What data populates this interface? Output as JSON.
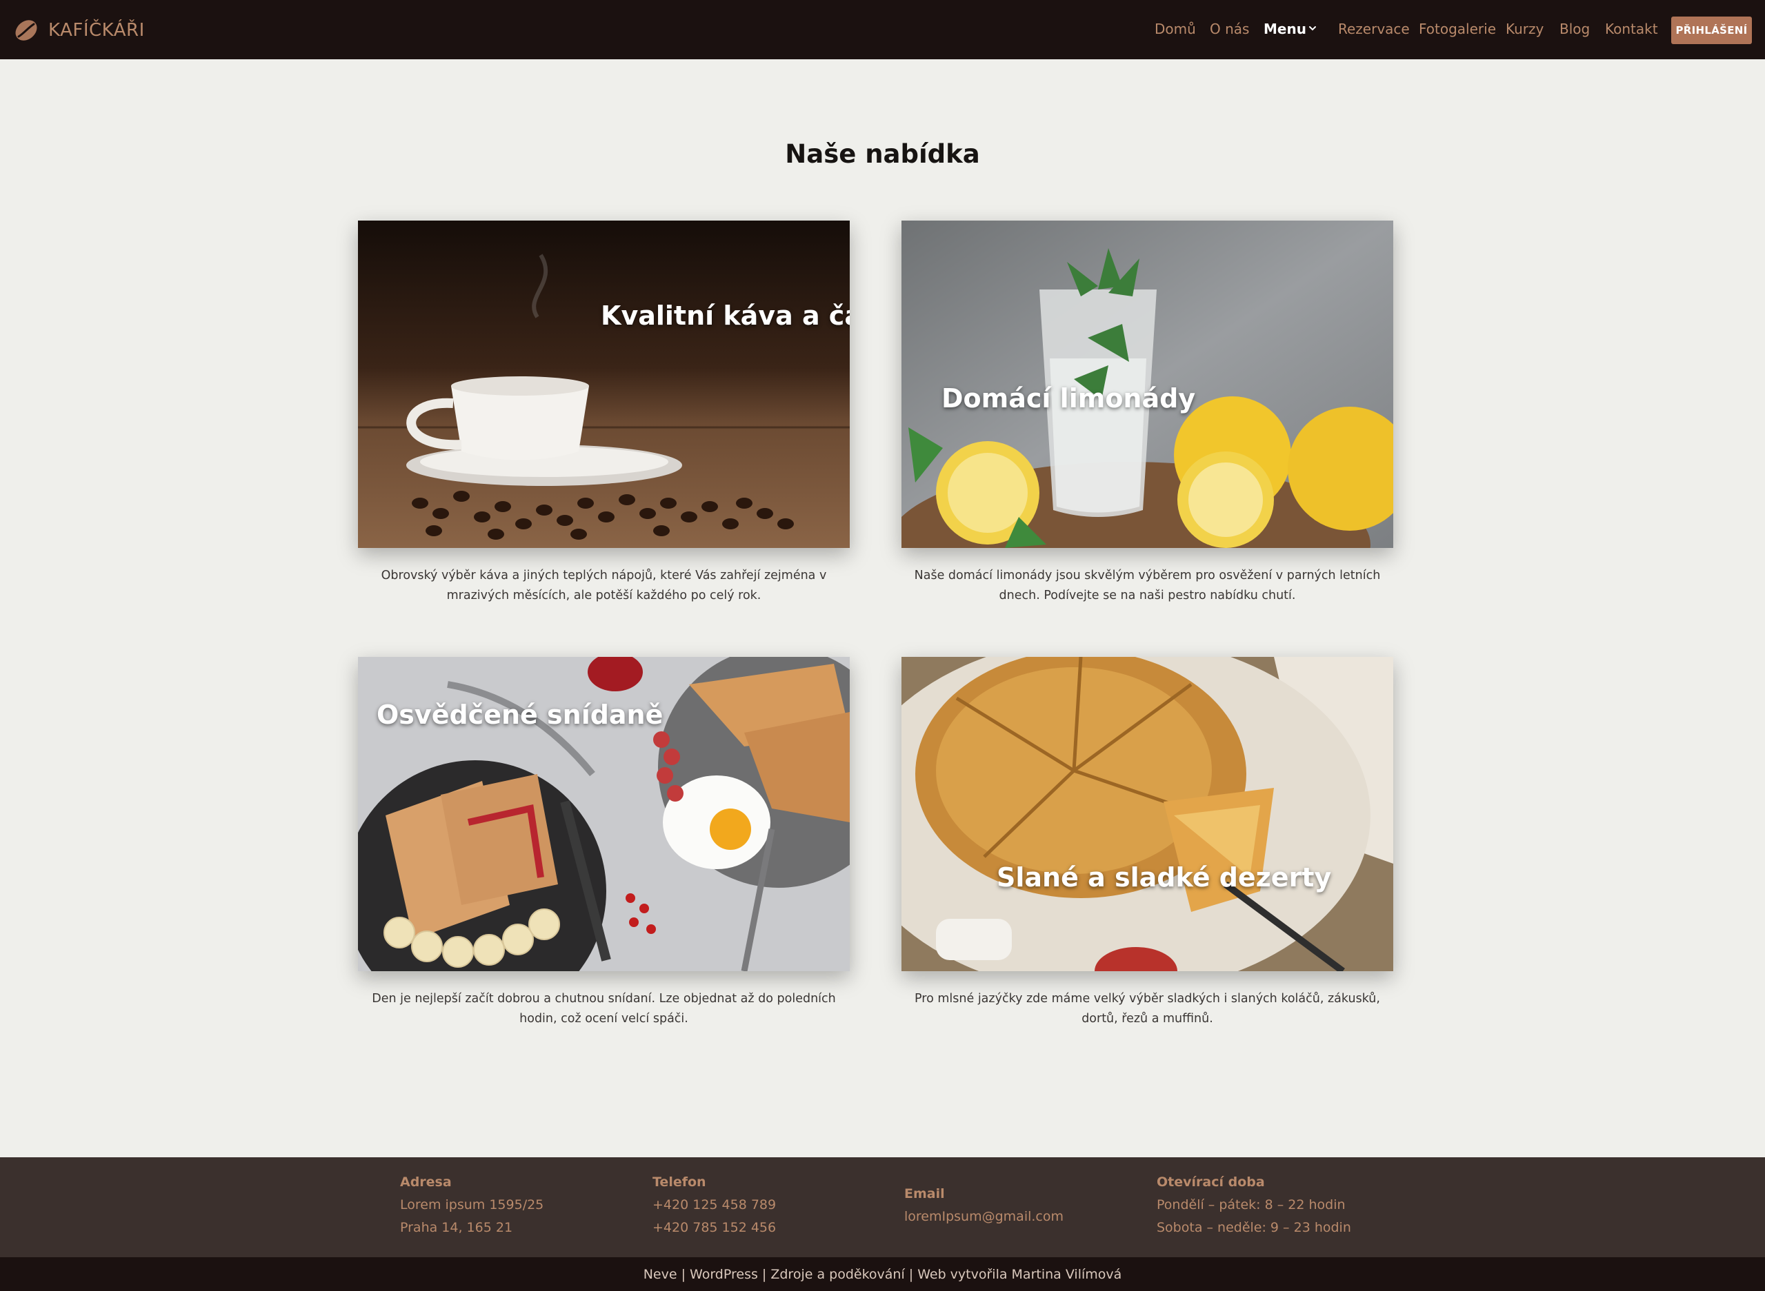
{
  "header": {
    "brand": "KAFÍČKÁŘI",
    "nav": [
      {
        "label": "Domů"
      },
      {
        "label": "O nás"
      },
      {
        "label": "Menu"
      },
      {
        "label": "Rezervace"
      },
      {
        "label": "Fotogalerie"
      },
      {
        "label": "Kurzy"
      },
      {
        "label": "Blog"
      },
      {
        "label": "Kontakt"
      }
    ],
    "login_label": "PŘIHLÁŠENÍ"
  },
  "main": {
    "title": "Naše nabídka",
    "cards": [
      {
        "overlay": "Kvalitní káva a čaj",
        "description": "Obrovský výběr káva a jiných teplých nápojů, které Vás zahřejí zejména v mrazivých měsících, ale potěší každého po celý rok."
      },
      {
        "overlay": "Domácí limonády",
        "description": "Naše domácí limonády jsou skvělým výběrem pro osvěžení v parných letních dnech. Podívejte se na naši pestro nabídku chutí."
      },
      {
        "overlay": "Osvědčené snídaně",
        "description": "Den je nejlepší začít dobrou a chutnou snídaní. Lze objednat až do poledních hodin, což ocení velcí spáči."
      },
      {
        "overlay": "Slané a sladké dezerty",
        "description": "Pro mlsné jazýčky zde máme velký výběr sladkých i slaných koláčů, zákusků, dortů, řezů a muffinů."
      }
    ]
  },
  "footer": {
    "address": {
      "heading": "Adresa",
      "line1": "Lorem ipsum 1595/25",
      "line2": "Praha 14, 165 21"
    },
    "phone": {
      "heading": "Telefon",
      "line1": "+420 125 458 789",
      "line2": "+420 785 152 456"
    },
    "email": {
      "heading": "Email",
      "line1": "loremIpsum@gmail.com"
    },
    "hours": {
      "heading": "Otevírací doba",
      "line1": "Pondělí – pátek: 8 – 22 hodin",
      "line2": "Sobota – neděle: 9 – 23 hodin"
    },
    "credits": "Neve | WordPress | Zdroje a poděkování | Web vytvořila Martina Vilímová"
  },
  "colors": {
    "header_bg": "#1b1110",
    "accent": "#b98a6b",
    "button_bg": "#b07457",
    "page_bg": "#efefeb",
    "footer_bg": "#3b302d"
  },
  "icons": {
    "logo": "coffee-bean-icon",
    "menu_dropdown": "chevron-down-icon"
  }
}
